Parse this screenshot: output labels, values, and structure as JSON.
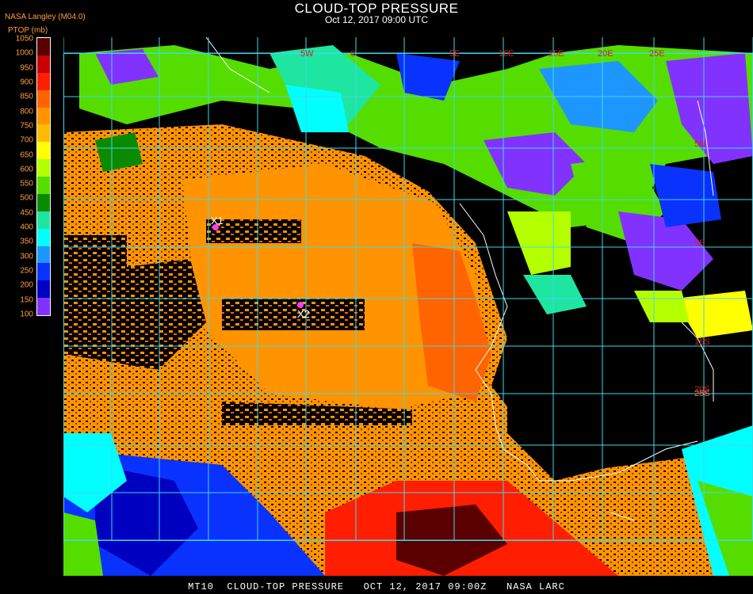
{
  "header": {
    "title": "CLOUD-TOP PRESSURE",
    "datetime": "Oct 12, 2017 09:00 UTC"
  },
  "legend": {
    "source": "NASA Langley (M04.0)",
    "unit": "PTOP (mb)",
    "ticks": [
      "1050",
      "1000",
      "950",
      "900",
      "850",
      "800",
      "750",
      "700",
      "650",
      "600",
      "550",
      "500",
      "450",
      "400",
      "350",
      "300",
      "250",
      "200",
      "150",
      "100"
    ],
    "colors": [
      "#5a0000",
      "#c80000",
      "#ff1e00",
      "#ff6400",
      "#ff9400",
      "#ffbb00",
      "#ffff00",
      "#b4ff00",
      "#55dd00",
      "#0a8a00",
      "#1ee6a0",
      "#00ffff",
      "#1e96ff",
      "#0a32ff",
      "#0000c0",
      "#8232ff"
    ]
  },
  "map": {
    "grid_color": "#40d8e8",
    "lat_labels": [
      "5N",
      "5S",
      "15S",
      "20S",
      "25S"
    ],
    "lon_labels": [
      "5W",
      "0",
      "5E",
      "10E",
      "15E",
      "20E",
      "25E"
    ],
    "markers": [
      {
        "label": "X1",
        "color": "#ff3bff"
      },
      {
        "label": "X2",
        "color": "#ff3bff"
      }
    ]
  },
  "footer": {
    "text": "MT10  CLOUD-TOP PRESSURE   OCT 12, 2017 09:00Z   NASA LARC"
  }
}
